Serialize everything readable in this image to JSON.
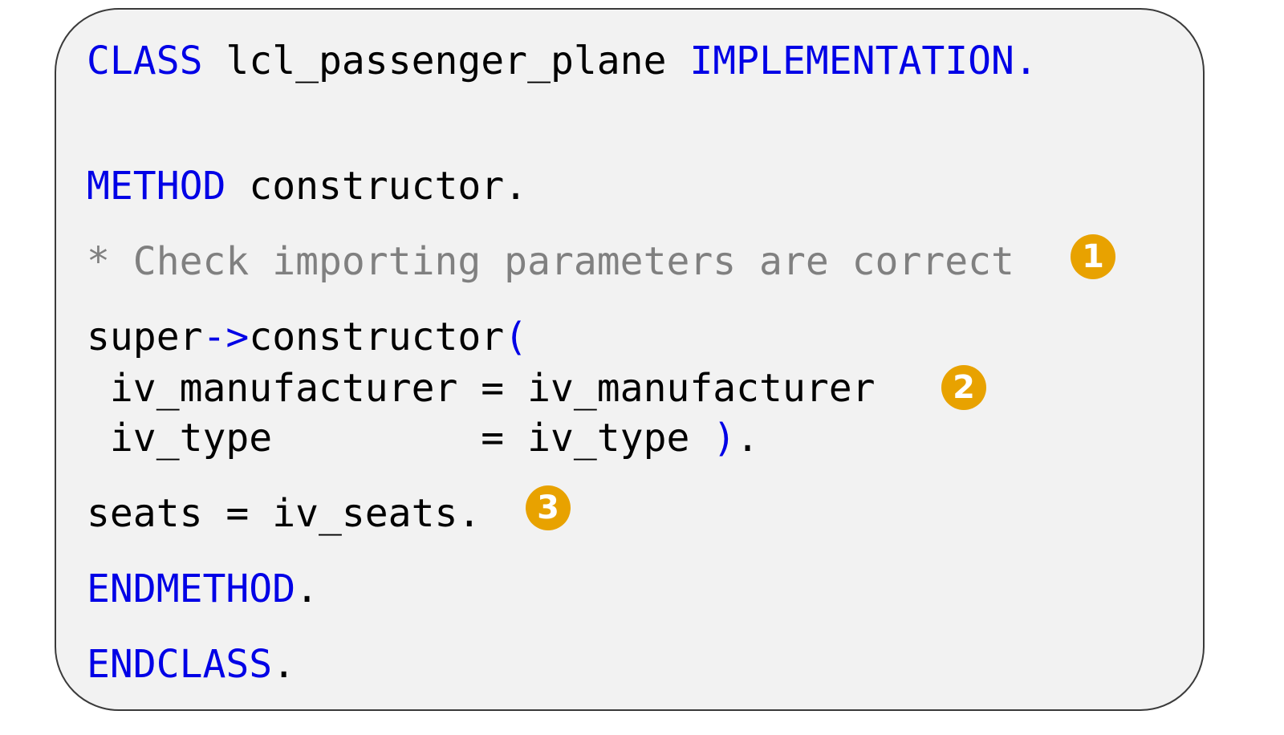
{
  "code": {
    "line1": {
      "kw1": "CLASS",
      "name": " lcl_passenger_plane ",
      "kw2": "IMPLEMENTATION."
    },
    "line2": {
      "kw": "METHOD",
      "rest": " constructor."
    },
    "line3": {
      "comment": "* Check importing parameters are correct"
    },
    "line4": {
      "obj": "super",
      "arrow": "->",
      "method": "constructor",
      "paren": "("
    },
    "line5": {
      "text": " iv_manufacturer = iv_manufacturer"
    },
    "line6": {
      "text": " iv_type         = iv_type ",
      "paren": ")",
      "end": "."
    },
    "line7": {
      "text": "seats = iv_seats."
    },
    "line8": {
      "kw": "ENDMETHOD",
      "end": "."
    },
    "line9": {
      "kw": "ENDCLASS",
      "end": "."
    }
  },
  "markers": [
    "1",
    "2",
    "3"
  ],
  "colors": {
    "keyword": "#0000e6",
    "comment": "#808080",
    "marker": "#e8a200",
    "panel": "#f2f2f2"
  }
}
